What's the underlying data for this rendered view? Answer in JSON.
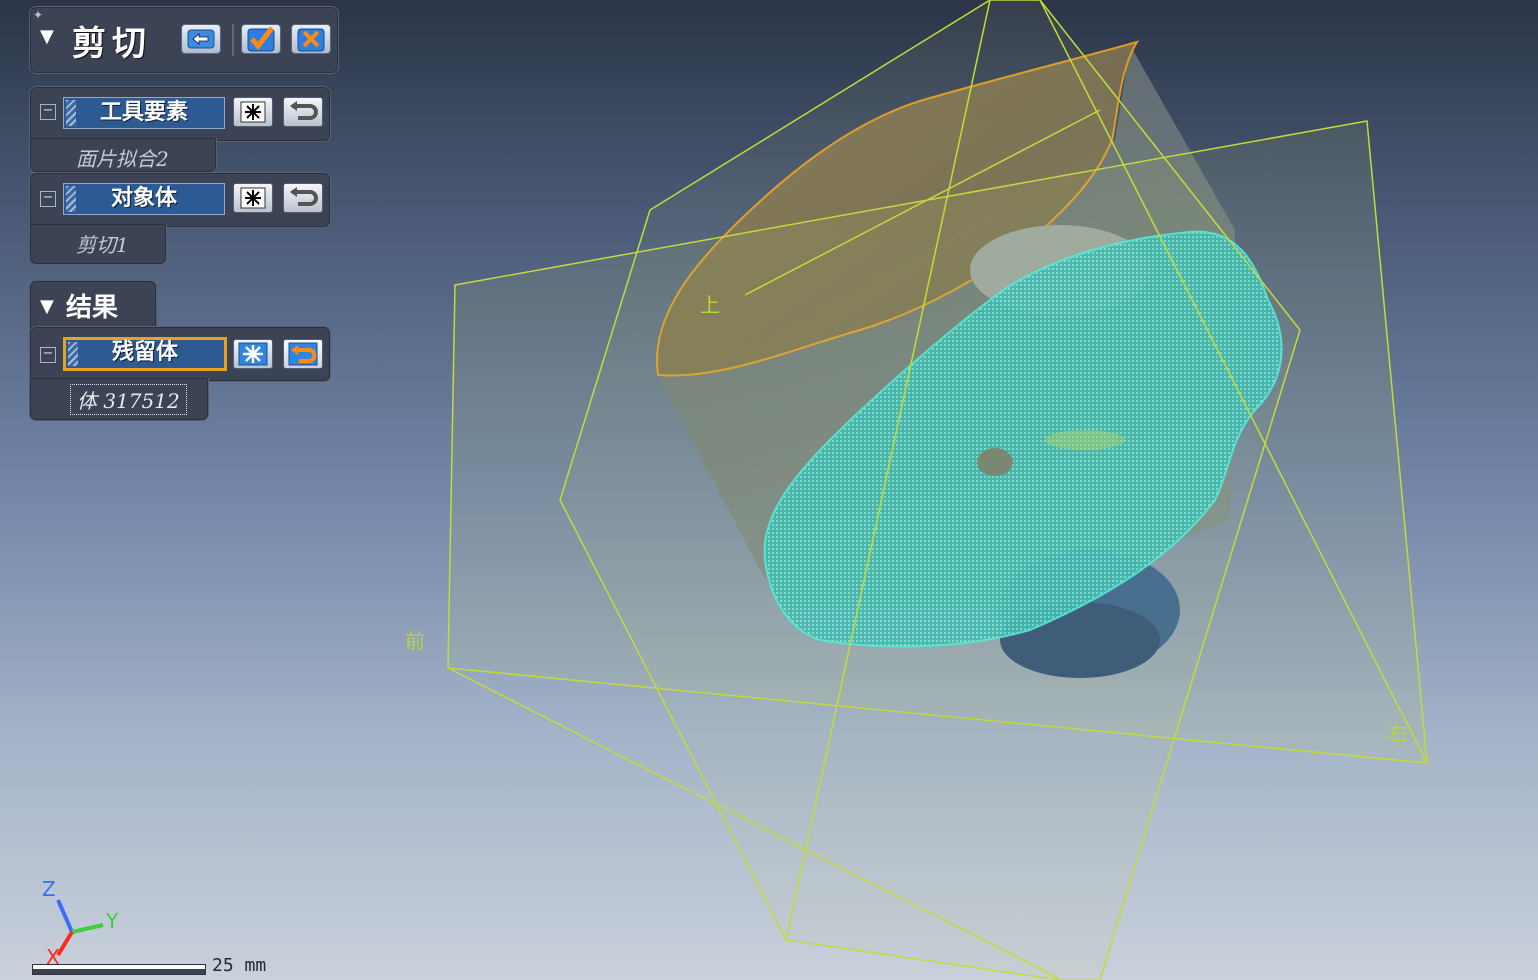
{
  "app": {
    "panel_title": "剪切",
    "pin_icon": "pin-icon",
    "buttons": {
      "back": "back-arrow-icon",
      "ok": "checkmark-icon",
      "cancel": "close-x-icon"
    }
  },
  "tool_elements": {
    "label": "工具要素",
    "value": "面片拟合2"
  },
  "target_body": {
    "label": "对象体",
    "value": "剪切1"
  },
  "result": {
    "header": "结果",
    "remain_label": "残留体",
    "remain_value": "体 317512"
  },
  "viewport": {
    "view_labels": {
      "top": "上",
      "front": "前",
      "right": "右"
    },
    "axes": {
      "x": "X",
      "y": "Y",
      "z": "Z"
    },
    "scale_label": "25 mm",
    "colors": {
      "plane_lines": "#c2db3a",
      "tool_surface": "#e8a020",
      "target_mesh": "#38e0dc",
      "body_dark": "#2f5c96",
      "selected_border": "#e5a51c"
    }
  }
}
